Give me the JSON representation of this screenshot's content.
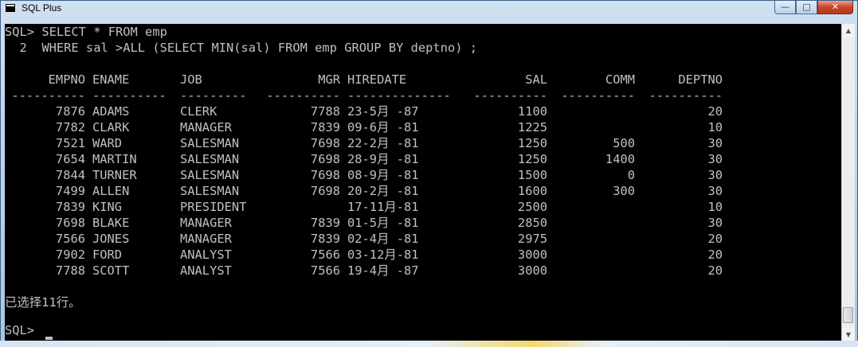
{
  "window": {
    "title": "SQL Plus"
  },
  "controls": {
    "minimize": "—",
    "maximize": "□",
    "close": "✕"
  },
  "scrollbar": {
    "up_arrow": "▲",
    "down_arrow": "▼"
  },
  "console": {
    "command_line1": "SQL> SELECT * FROM emp",
    "command_line2": "  2  WHERE sal >ALL (SELECT MIN(sal) FROM emp GROUP BY deptno) ;",
    "headers": [
      "EMPNO",
      "ENAME",
      "JOB",
      "MGR",
      "HIREDATE",
      "SAL",
      "COMM",
      "DEPTNO"
    ],
    "separators": [
      "----------",
      "----------",
      "---------",
      "----------",
      "--------------",
      "----------",
      "----------",
      "----------"
    ],
    "rows": [
      [
        "7876",
        "ADAMS",
        "CLERK",
        "7788",
        "23-5月 -87",
        "1100",
        "",
        "20"
      ],
      [
        "7782",
        "CLARK",
        "MANAGER",
        "7839",
        "09-6月 -81",
        "1225",
        "",
        "10"
      ],
      [
        "7521",
        "WARD",
        "SALESMAN",
        "7698",
        "22-2月 -81",
        "1250",
        "500",
        "30"
      ],
      [
        "7654",
        "MARTIN",
        "SALESMAN",
        "7698",
        "28-9月 -81",
        "1250",
        "1400",
        "30"
      ],
      [
        "7844",
        "TURNER",
        "SALESMAN",
        "7698",
        "08-9月 -81",
        "1500",
        "0",
        "30"
      ],
      [
        "7499",
        "ALLEN",
        "SALESMAN",
        "7698",
        "20-2月 -81",
        "1600",
        "300",
        "30"
      ],
      [
        "7839",
        "KING",
        "PRESIDENT",
        "",
        "17-11月-81",
        "2500",
        "",
        "10"
      ],
      [
        "7698",
        "BLAKE",
        "MANAGER",
        "7839",
        "01-5月 -81",
        "2850",
        "",
        "30"
      ],
      [
        "7566",
        "JONES",
        "MANAGER",
        "7839",
        "02-4月 -81",
        "2975",
        "",
        "20"
      ],
      [
        "7902",
        "FORD",
        "ANALYST",
        "7566",
        "03-12月-81",
        "3000",
        "",
        "20"
      ],
      [
        "7788",
        "SCOTT",
        "ANALYST",
        "7566",
        "19-4月 -87",
        "3000",
        "",
        "20"
      ]
    ],
    "result_message": "已选择11行。",
    "prompt": "SQL> "
  }
}
